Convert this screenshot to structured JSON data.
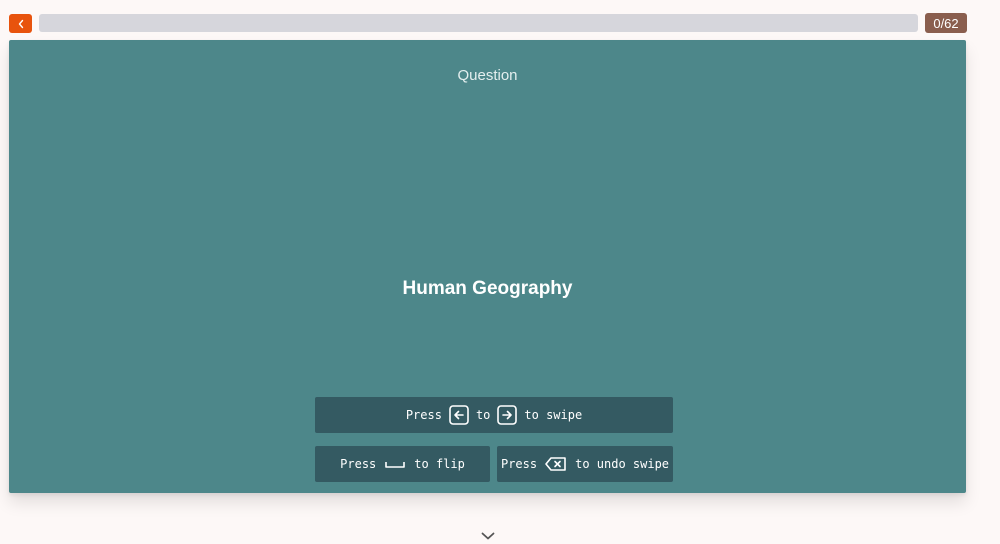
{
  "header": {
    "back_icon": "chevron-left-icon",
    "progress": {
      "current": 0,
      "total": 62,
      "fraction": 0
    },
    "counter_text": "0/62",
    "colors": {
      "back_button": "#e8530d",
      "progress_track": "#d6d6dc",
      "counter_bg": "#8a5e4e"
    }
  },
  "card": {
    "side_label": "Question",
    "term": "Human Geography",
    "color": "#4d878a"
  },
  "hints": {
    "swipe": {
      "press": "Press",
      "left_key_icon": "arrow-left-key-icon",
      "to": "to",
      "right_key_icon": "arrow-right-key-icon",
      "action": "to swipe"
    },
    "flip": {
      "press": "Press",
      "key_icon": "spacebar-key-icon",
      "action": "to flip"
    },
    "undo": {
      "press": "Press",
      "key_icon": "backspace-key-icon",
      "action": "to undo swipe"
    },
    "color": "#345a62"
  },
  "footer": {
    "expand_icon": "chevron-down-icon"
  }
}
